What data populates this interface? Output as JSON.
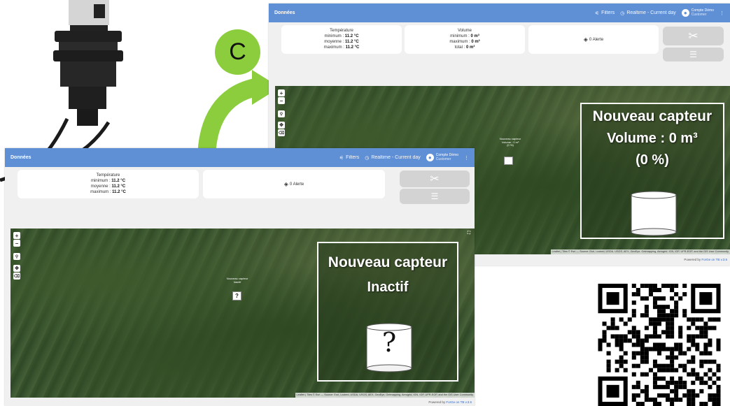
{
  "badge": {
    "letter": "C",
    "color": "#8ccd3d"
  },
  "dashboards": {
    "top": {
      "title": "Données",
      "filters": "Filters",
      "realtime": "Realtime - Current day",
      "user_name": "Compte Démo",
      "user_role": "Customer",
      "temperature": {
        "title": "Température",
        "min_label": "minimum :",
        "min": "11.2 °C",
        "avg_label": "moyenne :",
        "avg": "11.2 °C",
        "max_label": "maximum :",
        "max": "11.2 °C"
      },
      "volume": {
        "title": "Volume",
        "min_label": "minimum :",
        "min": "0 m³",
        "max_label": "maximum :",
        "max": "0 m³",
        "total_label": "total :",
        "total": "0 m³"
      },
      "alert": "0 Alerte",
      "marker_label_1": "Nouveau capteur",
      "marker_label_2": "Volume : 0 m³",
      "marker_label_3": "(0 %)",
      "zoom_title": "Nouveau capteur",
      "zoom_line2": "Volume : 0 m³",
      "zoom_line3": "(0 %)",
      "attribution": "Leaflet | Tiles © Esri — Source: Esri, i-cubed, USDA, USGS, AEX, GeoEye, Getmapping, Aerogrid, IGN, IGP, UPR-EGP, and the GIS User Community",
      "powered_prefix": "Powered by",
      "powered_link": "ForGe on TB v.3.5"
    },
    "bottom": {
      "title": "Données",
      "filters": "Filters",
      "realtime": "Realtime - Current day",
      "user_name": "Compte Démo",
      "user_role": "Customer",
      "temperature": {
        "title": "Température",
        "min_label": "minimum :",
        "min": "11.2 °C",
        "avg_label": "moyenne :",
        "avg": "11.2 °C",
        "max_label": "maximum :",
        "max": "11.2 °C"
      },
      "alert": "0 Alerte",
      "marker_label_1": "Nouveau capteur",
      "marker_label_2": "Inactif",
      "marker_symbol": "?",
      "zoom_title": "Nouveau capteur",
      "zoom_line2": "Inactif",
      "zoom_symbol": "?",
      "attribution": "Leaflet | Tiles © Esri — Source: Esri, i-cubed, USDA, USGS, AEX, GeoEye, Getmapping, Aerogrid, IGN, IGP, UPR-EGP, and the GIS User Community",
      "powered_prefix": "Powered by",
      "powered_link": "ForGe on TB v.3.5"
    }
  },
  "icons": [
    "filter-icon",
    "clock-icon",
    "account-icon",
    "more-vert-icon",
    "alert-icon",
    "tools-icon",
    "list-icon",
    "zoom-in-icon",
    "zoom-out-icon",
    "pin-icon",
    "move-icon",
    "eraser-icon",
    "fullscreen-icon"
  ]
}
